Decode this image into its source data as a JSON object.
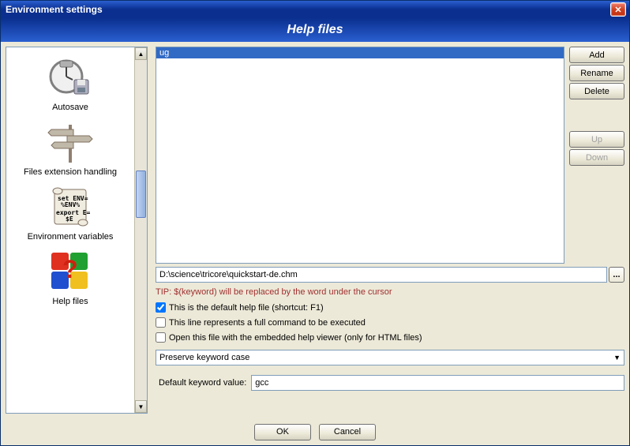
{
  "window": {
    "title": "Environment settings"
  },
  "header": {
    "title": "Help files"
  },
  "sidebar": {
    "items": [
      {
        "label": "Autosave"
      },
      {
        "label": "Files extension handling"
      },
      {
        "label": "Environment variables"
      },
      {
        "label": "Help files"
      }
    ]
  },
  "list": {
    "items": [
      "ug"
    ]
  },
  "buttons": {
    "add": "Add",
    "rename": "Rename",
    "delete": "Delete",
    "up": "Up",
    "down": "Down",
    "browse": "...",
    "ok": "OK",
    "cancel": "Cancel"
  },
  "path": "D:\\science\\tricore\\quickstart-de.chm",
  "tip": "TIP: $(keyword) will be replaced by the word under the cursor",
  "checks": {
    "default_help": {
      "label": "This is the default help file (shortcut: F1)",
      "checked": true
    },
    "full_command": {
      "label": "This line represents a full command to be executed",
      "checked": false
    },
    "embedded": {
      "label": "Open this file with the embedded help viewer (only for HTML files)",
      "checked": false
    }
  },
  "case_select": "Preserve keyword case",
  "default_kw_label": "Default keyword value:",
  "default_kw_value": "gcc"
}
